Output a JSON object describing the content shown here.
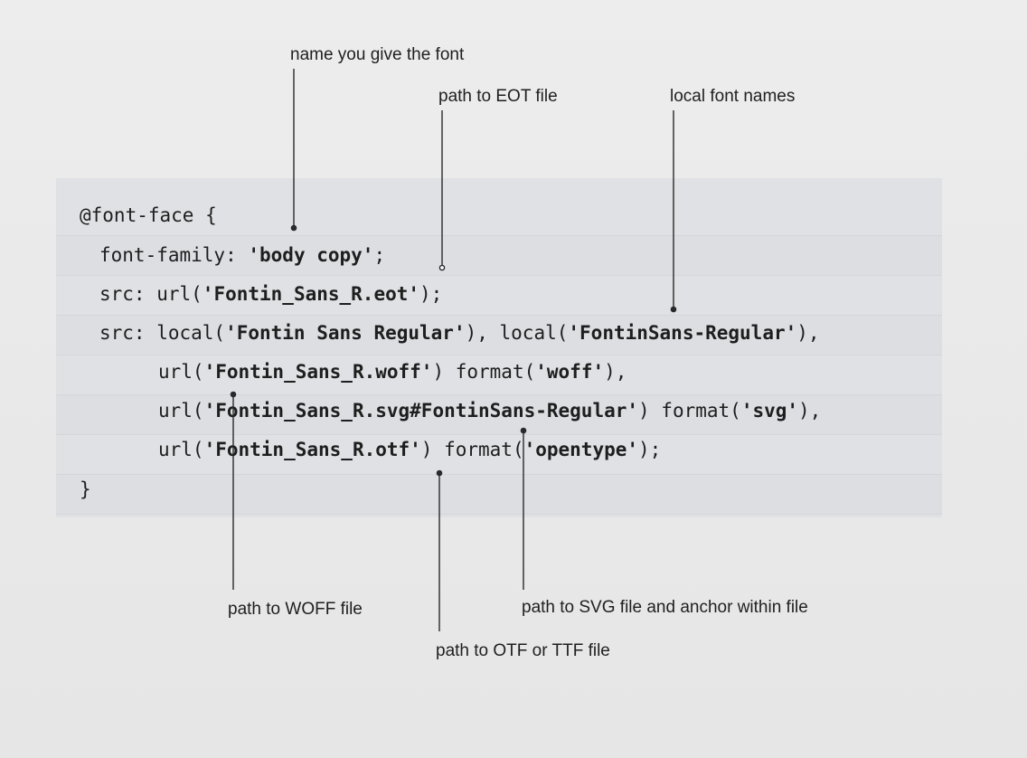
{
  "annotations": {
    "font_name": "name you give the font",
    "eot_path": "path to EOT file",
    "local_names": "local font names",
    "woff_path": "path to WOFF file",
    "svg_path": "path to SVG file and anchor within file",
    "otf_path": "path to OTF or TTF file"
  },
  "code": {
    "line1": "@font-face {",
    "line2_prop": "font-family: ",
    "line2_val": "'body copy'",
    "line2_end": ";",
    "line3_prop": "src: url(",
    "line3_val": "'Fontin_Sans_R.eot'",
    "line3_end": ");",
    "line4_prop": "src: local(",
    "line4_val1": "'Fontin Sans Regular'",
    "line4_mid": "), local(",
    "line4_val2": "'FontinSans-Regular'",
    "line4_end": "),",
    "line5_prop": "url(",
    "line5_val1": "'Fontin_Sans_R.woff'",
    "line5_mid": ") format(",
    "line5_val2": "'woff'",
    "line5_end": "),",
    "line6_prop": "url(",
    "line6_val1": "'Fontin_Sans_R.svg#FontinSans-Regular'",
    "line6_mid": ") format(",
    "line6_val2": "'svg'",
    "line6_end": "),",
    "line7_prop": "url(",
    "line7_val1": "'Fontin_Sans_R.otf'",
    "line7_mid": ") format(",
    "line7_val2": "'opentype'",
    "line7_end": ");",
    "line8": "}"
  }
}
